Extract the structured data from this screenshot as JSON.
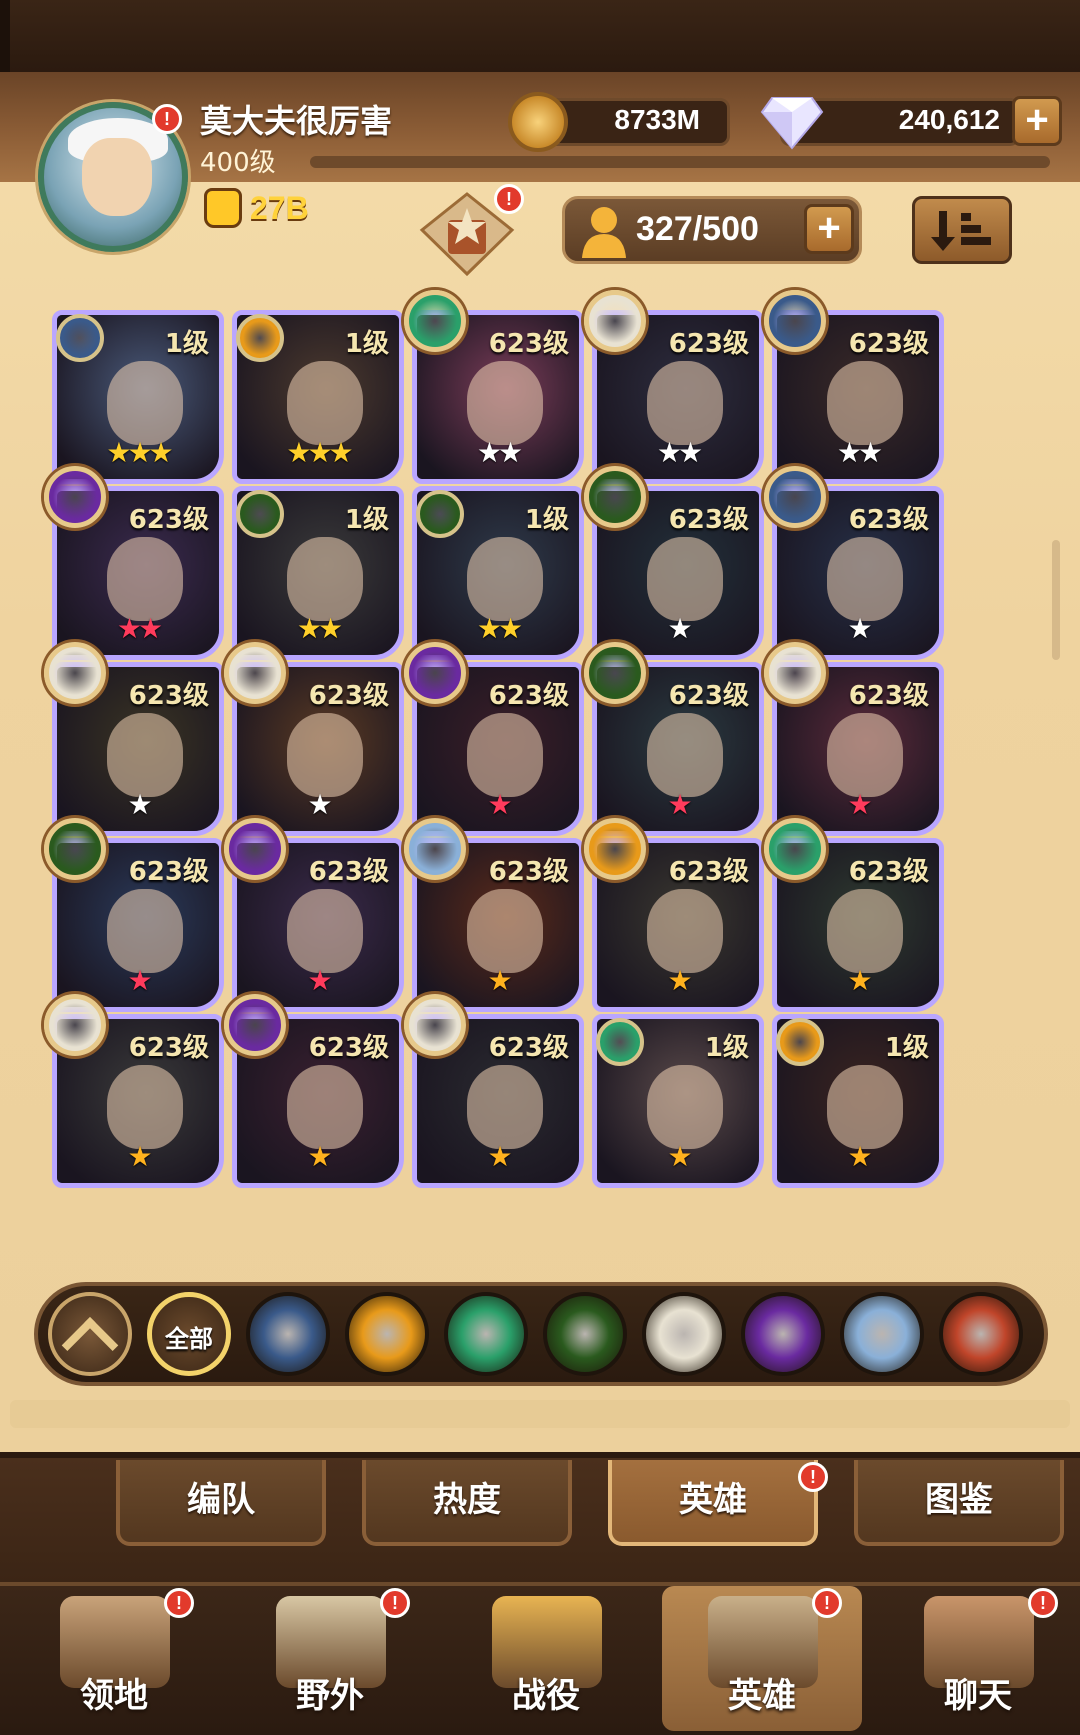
{
  "player": {
    "name": "莫大夫很厉害",
    "level": "400级",
    "power": "27B",
    "gold": "8733M",
    "diamonds": "240,612"
  },
  "roster": {
    "count": "327/500"
  },
  "heroes": [
    {
      "level": "1级",
      "stars": "★★★",
      "star_color": "#ffd02a",
      "faction": "lightbearer",
      "bg": "#4a5a7a",
      "ascended": false
    },
    {
      "level": "1级",
      "stars": "★★★",
      "star_color": "#ffd02a",
      "faction": "mauler",
      "bg": "#4c3a2e",
      "ascended": false
    },
    {
      "level": "623级",
      "stars": "★★",
      "star_color": "#ffffff",
      "faction": "wilder",
      "bg": "#7a3c58",
      "ascended": true
    },
    {
      "level": "623级",
      "stars": "★★",
      "star_color": "#ffffff",
      "faction": "celestial",
      "bg": "#2d2d3e",
      "ascended": true
    },
    {
      "level": "623级",
      "stars": "★★",
      "star_color": "#ffffff",
      "faction": "lightbearer",
      "bg": "#3a2a28",
      "ascended": true
    },
    {
      "level": "623级",
      "stars": "★★",
      "star_color": "#ff3b5c",
      "faction": "hypogean",
      "bg": "#3a2a4e",
      "ascended": true
    },
    {
      "level": "1级",
      "stars": "★★",
      "star_color": "#ffd02a",
      "faction": "graveborn",
      "bg": "#3a3a3a",
      "ascended": false
    },
    {
      "level": "1级",
      "stars": "★★",
      "star_color": "#ffd02a",
      "faction": "graveborn",
      "bg": "#2e3a4a",
      "ascended": false
    },
    {
      "level": "623级",
      "stars": "★",
      "star_color": "#ffffff",
      "faction": "graveborn",
      "bg": "#22303a",
      "ascended": true
    },
    {
      "level": "623级",
      "stars": "★",
      "star_color": "#ffffff",
      "faction": "lightbearer",
      "bg": "#263048",
      "ascended": true
    },
    {
      "level": "623级",
      "stars": "★",
      "star_color": "#ffffff",
      "faction": "celestial",
      "bg": "#3a3424",
      "ascended": true
    },
    {
      "level": "623级",
      "stars": "★",
      "star_color": "#ffffff",
      "faction": "celestial",
      "bg": "#5a3a24",
      "ascended": true
    },
    {
      "level": "623级",
      "stars": "★",
      "star_color": "#ff3b5c",
      "faction": "hypogean",
      "bg": "#3a1e28",
      "ascended": true
    },
    {
      "level": "623级",
      "stars": "★",
      "star_color": "#ff3b5c",
      "faction": "graveborn",
      "bg": "#2a3a40",
      "ascended": true
    },
    {
      "level": "623级",
      "stars": "★",
      "star_color": "#ff3b5c",
      "faction": "celestial",
      "bg": "#5a2a3a",
      "ascended": true
    },
    {
      "level": "623级",
      "stars": "★",
      "star_color": "#ff3b5c",
      "faction": "graveborn",
      "bg": "#2a3a5a",
      "ascended": true
    },
    {
      "level": "623级",
      "stars": "★",
      "star_color": "#ff3b5c",
      "faction": "hypogean",
      "bg": "#3a2a4a",
      "ascended": true
    },
    {
      "level": "623级",
      "stars": "★",
      "star_color": "#ffb21e",
      "faction": "dimensional",
      "bg": "#5a2a1a",
      "ascended": true
    },
    {
      "level": "623级",
      "stars": "★",
      "star_color": "#ffb21e",
      "faction": "mauler",
      "bg": "#3a3830",
      "ascended": true
    },
    {
      "level": "623级",
      "stars": "★",
      "star_color": "#ffb21e",
      "faction": "wilder",
      "bg": "#2e3a30",
      "ascended": true
    },
    {
      "level": "623级",
      "stars": "★",
      "star_color": "#ffb21e",
      "faction": "celestial",
      "bg": "#3a3a3a",
      "ascended": true
    },
    {
      "level": "623级",
      "stars": "★",
      "star_color": "#ffb21e",
      "faction": "hypogean",
      "bg": "#3a2030",
      "ascended": true
    },
    {
      "level": "623级",
      "stars": "★",
      "star_color": "#ffb21e",
      "faction": "celestial",
      "bg": "#2a2a30",
      "ascended": true
    },
    {
      "level": "1级",
      "stars": "★",
      "star_color": "#ffb21e",
      "faction": "wilder",
      "bg": "#5a4a4a",
      "ascended": false
    },
    {
      "level": "1级",
      "stars": "★",
      "star_color": "#ffb21e",
      "faction": "mauler",
      "bg": "#3a2420",
      "ascended": false
    }
  ],
  "faction_filter": {
    "all_label": "全部",
    "buttons": [
      "ascend-filter",
      "all",
      "lightbearer",
      "mauler",
      "wilder",
      "graveborn",
      "celestial",
      "hypogean",
      "dimensional",
      "draconis"
    ],
    "colors": {
      "ascend-filter": "#6b4a2c",
      "lightbearer": "#3a5a8a",
      "mauler": "#e89a1a",
      "wilder": "#2aa06a",
      "graveborn": "#2a5a1e",
      "celestial": "#e8e2d2",
      "hypogean": "#6a2aa0",
      "dimensional": "#8ab0d8",
      "draconis": "#c0452a"
    }
  },
  "subtabs": [
    {
      "label": "编队",
      "selected": false,
      "badge": false
    },
    {
      "label": "热度",
      "selected": false,
      "badge": false
    },
    {
      "label": "英雄",
      "selected": true,
      "badge": true
    },
    {
      "label": "图鉴",
      "selected": false,
      "badge": false
    }
  ],
  "nav": [
    {
      "label": "领地",
      "icon": "castle-icon",
      "selected": false
    },
    {
      "label": "野外",
      "icon": "map-scroll-icon",
      "selected": false
    },
    {
      "label": "战役",
      "icon": "sword-shield-icon",
      "selected": false
    },
    {
      "label": "英雄",
      "icon": "knight-helmet-icon",
      "selected": true
    },
    {
      "label": "聊天",
      "icon": "chat-bubble-icon",
      "selected": false
    }
  ],
  "badge_text": "!"
}
